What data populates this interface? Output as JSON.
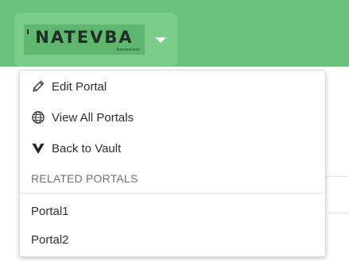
{
  "header": {
    "logo_text": "NATEVBA",
    "logo_subtext": "Restaurant",
    "logo_tick": "'",
    "caret_icon": "chevron-down-icon"
  },
  "colors": {
    "header_bg": "#69c17b",
    "switcher_bg": "#7ccd8b",
    "logo_bg": "#5fb66f"
  },
  "dropdown": {
    "items": [
      {
        "label": "Edit Portal",
        "icon": "pencil-icon"
      },
      {
        "label": "View All Portals",
        "icon": "globe-icon"
      },
      {
        "label": "Back to Vault",
        "icon": "vault-logo-icon"
      }
    ],
    "related_header": "RELATED PORTALS",
    "related": [
      {
        "label": "Portal1"
      },
      {
        "label": "Portal2"
      }
    ]
  }
}
